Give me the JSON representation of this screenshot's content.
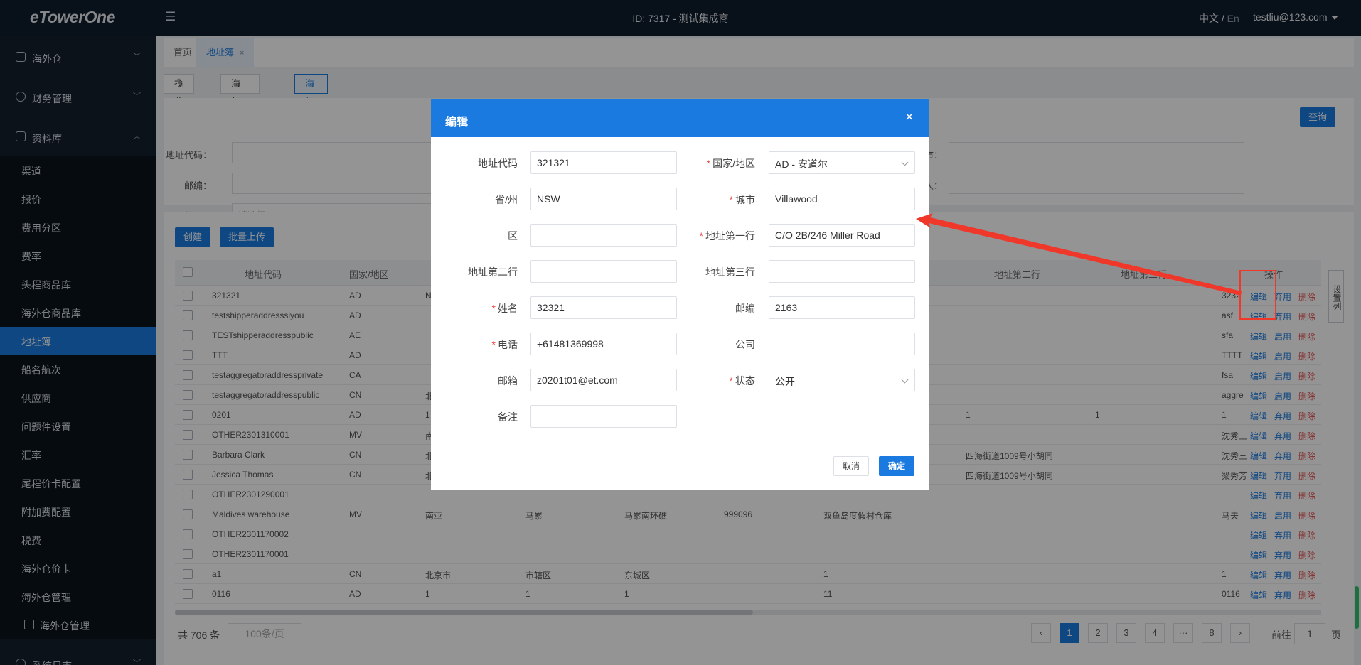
{
  "topbar": {
    "logo": "eTowerOne",
    "center_title": "ID: 7317 - 测试集成商",
    "lang_zh": "中文 /",
    "lang_en": " En",
    "user": "testliu@123.com"
  },
  "sidebar": {
    "groups": [
      {
        "label": "海外仓",
        "icon": "warehouse-icon"
      },
      {
        "label": "财务管理",
        "icon": "currency-icon"
      },
      {
        "label": "资料库",
        "icon": "library-icon"
      },
      {
        "label": "系统日志",
        "icon": "log-icon"
      }
    ],
    "items": [
      "渠道",
      "报价",
      "费用分区",
      "费率",
      "头程商品库",
      "海外仓商品库",
      "地址簿",
      "船名航次",
      "供应商",
      "问题件设置",
      "汇率",
      "尾程价卡配置",
      "附加费配置",
      "税费",
      "海外仓价卡",
      "海外仓管理",
      "海外仓管理"
    ],
    "active_item": "地址簿"
  },
  "page_tabs": {
    "home": "首页",
    "current": "地址簿",
    "close": "×"
  },
  "sub_tabs": [
    "揽收仓",
    "海外仓-FBA",
    "海外仓-其它"
  ],
  "filter": {
    "address_code_label": "地址代码：",
    "postcode_label": "邮编：",
    "status_label": "状态：",
    "status_placeholder": "请选择",
    "city_label_partial": "市：",
    "contact_label_partial": "人：",
    "query_button": "查询"
  },
  "actions": {
    "create": "创建",
    "batch_upload": "批量上传"
  },
  "table": {
    "headers": [
      "地址代码",
      "国家/地区",
      "地址第二行",
      "地址第三行",
      "操作"
    ],
    "op_labels": {
      "edit": "编辑",
      "disable": "弃用",
      "enable": "启用",
      "delete": "删除"
    },
    "rows": [
      {
        "code": "321321",
        "country": "AD",
        "c3": "N",
        "c4": "",
        "c5": "",
        "c6": "",
        "c7": "",
        "c8": "",
        "c9": "",
        "c10": "3232",
        "op2": "弃用"
      },
      {
        "code": "testshipperaddresssiyou",
        "country": "AD",
        "c3": "",
        "c4": "",
        "c5": "",
        "c6": "",
        "c7": "",
        "c8": "",
        "c9": "",
        "c10": "asf",
        "op2": "弃用"
      },
      {
        "code": "TESTshipperaddresspublic",
        "country": "AE",
        "c3": "",
        "c4": "",
        "c5": "",
        "c6": "",
        "c7": "",
        "c8": "",
        "c9": "",
        "c10": "sfa",
        "op2": "启用"
      },
      {
        "code": "TTT",
        "country": "AD",
        "c3": "",
        "c4": "",
        "c5": "",
        "c6": "",
        "c7": "",
        "c8": "",
        "c9": "",
        "c10": "TTTT",
        "op2": "启用"
      },
      {
        "code": "testaggregatoraddressprivate",
        "country": "CA",
        "c3": "",
        "c4": "",
        "c5": "",
        "c6": "",
        "c7": "",
        "c8": "",
        "c9": "",
        "c10": "fsa",
        "op2": "启用"
      },
      {
        "code": "testaggregatoraddresspublic",
        "country": "CN",
        "c3": "北",
        "c4": "",
        "c5": "",
        "c6": "",
        "c7": "",
        "c8": "",
        "c9": "",
        "c10": "aggre",
        "op2": "启用"
      },
      {
        "code": "0201",
        "country": "AD",
        "c3": "1",
        "c4": "",
        "c5": "",
        "c6": "",
        "c7": "",
        "c8": "1",
        "c9": "1",
        "c10": "1",
        "op2": "弃用"
      },
      {
        "code": "OTHER2301310001",
        "country": "MV",
        "c3": "南",
        "c4": "",
        "c5": "",
        "c6": "",
        "c7": "",
        "c8": "",
        "c9": "",
        "c10": "沈秀三",
        "op2": "弃用"
      },
      {
        "code": "Barbara Clark",
        "country": "CN",
        "c3": "北",
        "c4": "",
        "c5": "",
        "c6": "",
        "c7": "",
        "c8": "四海街道1009号小胡同",
        "c9": "",
        "c10": "沈秀三",
        "op2": "弃用"
      },
      {
        "code": "Jessica Thomas",
        "country": "CN",
        "c3": "北",
        "c4": "",
        "c5": "",
        "c6": "",
        "c7": "",
        "c8": "四海街道1009号小胡同",
        "c9": "",
        "c10": "梁秀芳",
        "op2": "弃用"
      },
      {
        "code": "OTHER2301290001",
        "country": "",
        "c3": "",
        "c4": "",
        "c5": "",
        "c6": "",
        "c7": "",
        "c8": "",
        "c9": "",
        "c10": "",
        "op2": "弃用"
      },
      {
        "code": "Maldives warehouse",
        "country": "MV",
        "c3": "南亚",
        "c4": "马累",
        "c5": "马累南环礁",
        "c6": "999096",
        "c7": "双鱼岛度假村仓库",
        "c8": "",
        "c9": "",
        "c10": "马夫",
        "op2": "启用"
      },
      {
        "code": "OTHER2301170002",
        "country": "",
        "c3": "",
        "c4": "",
        "c5": "",
        "c6": "",
        "c7": "",
        "c8": "",
        "c9": "",
        "c10": "",
        "op2": "弃用"
      },
      {
        "code": "OTHER2301170001",
        "country": "",
        "c3": "",
        "c4": "",
        "c5": "",
        "c6": "",
        "c7": "",
        "c8": "",
        "c9": "",
        "c10": "",
        "op2": "弃用"
      },
      {
        "code": "a1",
        "country": "CN",
        "c3": "北京市",
        "c4": "市辖区",
        "c5": "东城区",
        "c6": "",
        "c7": "1",
        "c8": "",
        "c9": "",
        "c10": "1",
        "op2": "弃用"
      },
      {
        "code": "0116",
        "country": "AD",
        "c3": "1",
        "c4": "1",
        "c5": "1",
        "c6": "",
        "c7": "11",
        "c8": "",
        "c9": "",
        "c10": "0116",
        "op2": "弃用"
      }
    ]
  },
  "side_settings": "设置列",
  "pagination": {
    "total": "共 706 条",
    "page_size": "100条/页",
    "pages": [
      "1",
      "2",
      "3",
      "4",
      "···",
      "8"
    ],
    "prev": "‹",
    "next": "›",
    "goto_label": "前往",
    "goto_value": "1",
    "goto_suffix": "页"
  },
  "modal": {
    "title": "编辑",
    "close": "×",
    "fields": {
      "address_code": {
        "label": "地址代码",
        "value": "321321",
        "required": false
      },
      "country": {
        "label": "国家/地区",
        "value": "AD - 安道尔",
        "required": true
      },
      "province": {
        "label": "省/州",
        "value": "NSW",
        "required": false
      },
      "city": {
        "label": "城市",
        "value": "Villawood",
        "required": true
      },
      "district": {
        "label": "区",
        "value": "",
        "required": false
      },
      "address1": {
        "label": "地址第一行",
        "value": "C/O 2B/246 Miller Road",
        "required": true
      },
      "address2": {
        "label": "地址第二行",
        "value": "",
        "required": false
      },
      "address3": {
        "label": "地址第三行",
        "value": "",
        "required": false
      },
      "name": {
        "label": "姓名",
        "value": "32321",
        "required": true
      },
      "postcode": {
        "label": "邮编",
        "value": "2163",
        "required": false
      },
      "phone": {
        "label": "电话",
        "value": "+61481369998",
        "required": true
      },
      "company": {
        "label": "公司",
        "value": "",
        "required": false
      },
      "email": {
        "label": "邮箱",
        "value": "z0201t01@et.com",
        "required": false
      },
      "status": {
        "label": "状态",
        "value": "公开",
        "required": true
      },
      "remark": {
        "label": "备注",
        "value": "",
        "required": false
      }
    },
    "cancel": "取消",
    "confirm": "确定",
    "required_mark": "*"
  },
  "annotation": {
    "color": "#f0382a"
  }
}
